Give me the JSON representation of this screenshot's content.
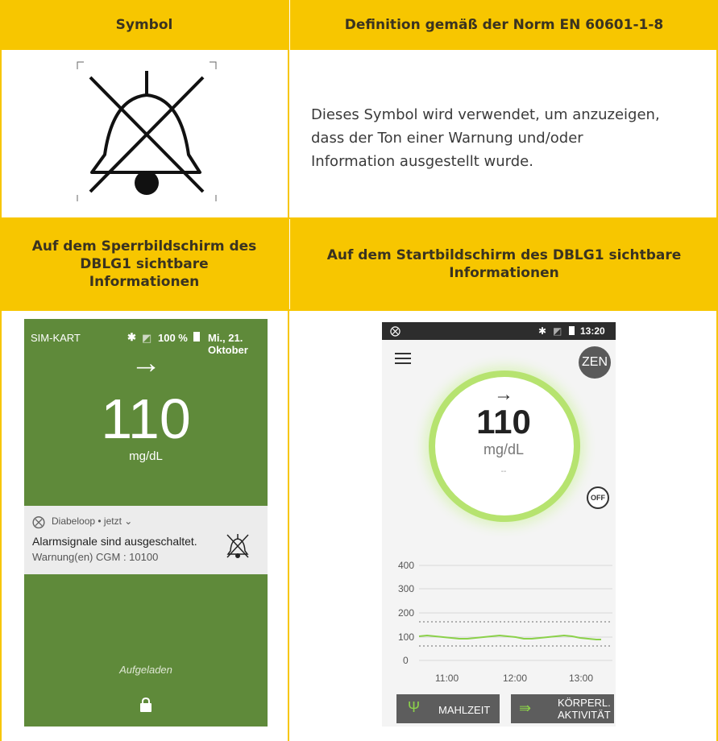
{
  "table": {
    "header_symbol": "Symbol",
    "header_definition": "Definition gemäß der Norm EN 60601-1-8",
    "definition_text_1": "Dieses Symbol wird verwendet, um anzuzeigen,",
    "definition_text_2": "dass der Ton einer Warnung und/oder",
    "definition_text_3": "Information ausgestellt wurde.",
    "header_lock_1": "Auf dem Sperrbildschirm des",
    "header_lock_2": "DBLG1 sichtbare",
    "header_lock_3": "Informationen",
    "header_home_1": "Auf dem Startbildschirm des DBLG1 sichtbare",
    "header_home_2": "Informationen"
  },
  "lock_screen": {
    "carrier": "SIM-KART",
    "battery": "100 %",
    "date": "Mi., 21. Oktober",
    "arrow": "→",
    "glucose": "110",
    "unit": "mg/dL",
    "notif_app": "Diabeloop • jetzt ⌄",
    "notif_title": "Alarmsignale sind ausgeschaltet.",
    "notif_body": "Warnung(en) CGM : 10100",
    "charging": "Aufgeladen"
  },
  "home_screen": {
    "time": "13:20",
    "mode_badge": "ZEN",
    "arrow": "→",
    "glucose": "110",
    "unit": "mg/dL",
    "dash": "--",
    "off_badge": "OFF",
    "y_ticks": [
      "400",
      "300",
      "200",
      "100",
      "0"
    ],
    "x_ticks": [
      "11:00",
      "12:00",
      "13:00"
    ],
    "meal_button": "MAHLZEIT",
    "activity_button_1": "KÖRPERL.",
    "activity_button_2": "AKTIVITÄT"
  },
  "colors": {
    "accent": "#f7c600",
    "lock_bg": "#5f8a3a",
    "ring": "#7ed321"
  }
}
